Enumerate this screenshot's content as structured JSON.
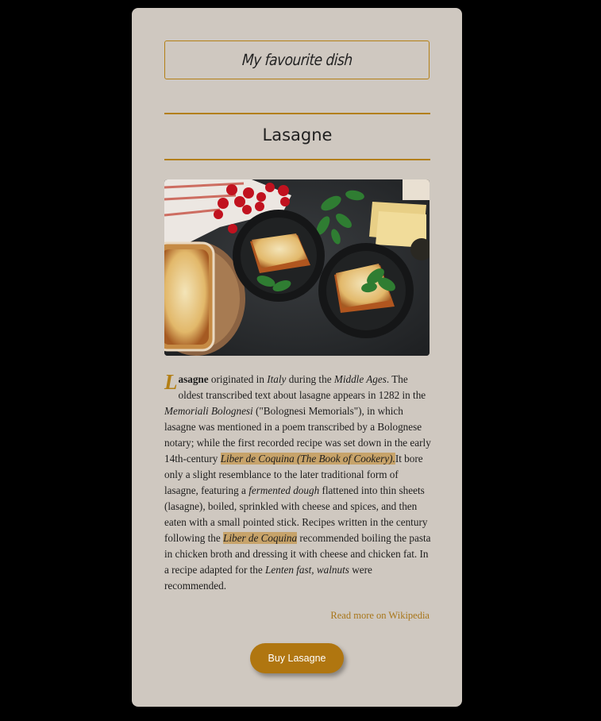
{
  "header": {
    "label": "My favourite dish"
  },
  "dish": {
    "name": "Lasagne"
  },
  "photo": {
    "subject": "lasagne on plates with tomatoes, basil and pasta sheets"
  },
  "article": {
    "dropcap": "L",
    "word_rest": "asagne",
    "t1": " originated in ",
    "italy": "Italy",
    "t2": " during the ",
    "middle_ages": "Middle Ages",
    "t3": ". The oldest transcribed text about lasagne appears in 1282 in the ",
    "memoriali": "Memoriali Bolognesi",
    "t4": " (\"Bolognesi Memorials\"), in which lasagne was mentioned in a poem transcribed by a Bolognese notary; while the first recorded recipe was set down in the early 14th-century ",
    "liber1": "Liber de Coquina (The Book of Cookery).",
    "t5": "It bore only a slight resemblance to the later traditional form of lasagne, featuring a ",
    "fermented": "fermented dough",
    "t6": " flattened into thin sheets (lasagne), boiled, sprinkled with cheese and spices, and then eaten with a small pointed stick. Recipes written in the century following the ",
    "liber2": "Liber de Coquina",
    "t7": " recommended boiling the pasta in chicken broth and dressing it with cheese and chicken fat. In a recipe adapted for the ",
    "lenten": "Lenten fast, walnuts",
    "t8": " were recommended."
  },
  "links": {
    "read_more": "Read more on Wikipedia"
  },
  "actions": {
    "buy": "Buy Lasagne"
  },
  "colors": {
    "accent": "#b37f15",
    "card": "#cfc8c0",
    "highlight": "#c7a36a",
    "background": "#000000"
  }
}
